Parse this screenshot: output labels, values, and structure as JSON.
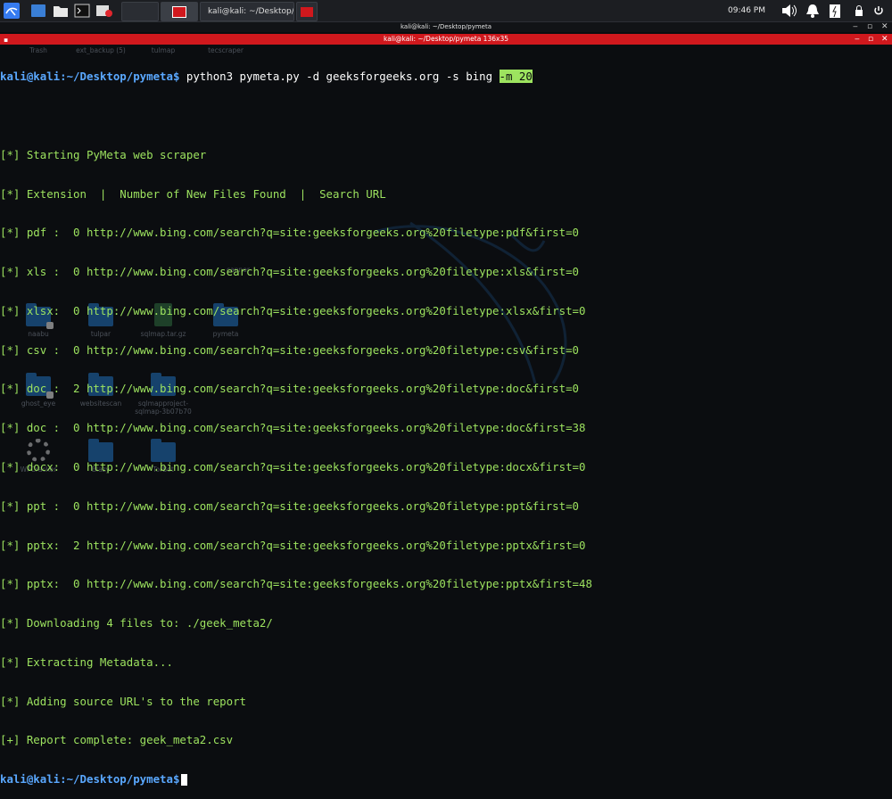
{
  "panel": {
    "tasks": [
      {
        "label": "kali@kali: ~/Desktop/py..."
      }
    ],
    "clock": "09:46 PM",
    "icons": [
      "kali-menu-icon",
      "workspace-icon",
      "files-icon",
      "terminal-icon",
      "screenrecorder-icon",
      "speaker-icon",
      "notification-icon",
      "power-manager-icon",
      "lock-icon",
      "power-icon"
    ]
  },
  "terminal": {
    "title_small": "kali@kali: ~/Desktop/pymeta",
    "title": "kali@kali: ~/Desktop/pymeta 136x35",
    "prompt_user": "kali@kali",
    "prompt_path": ":~/Desktop/pymeta$",
    "command": " python3 pymeta.py -d geeksforgeeks.org -s bing ",
    "command_tail": "-m 20",
    "lines": [
      "[*] Starting PyMeta web scraper",
      "[*] Extension  |  Number of New Files Found  |  Search URL",
      "[*] pdf :  0 http://www.bing.com/search?q=site:geeksforgeeks.org%20filetype:pdf&first=0",
      "[*] xls :  0 http://www.bing.com/search?q=site:geeksforgeeks.org%20filetype:xls&first=0",
      "[*] xlsx:  0 http://www.bing.com/search?q=site:geeksforgeeks.org%20filetype:xlsx&first=0",
      "[*] csv :  0 http://www.bing.com/search?q=site:geeksforgeeks.org%20filetype:csv&first=0",
      "[*] doc :  2 http://www.bing.com/search?q=site:geeksforgeeks.org%20filetype:doc&first=0",
      "[*] doc :  0 http://www.bing.com/search?q=site:geeksforgeeks.org%20filetype:doc&first=38",
      "[*] docx:  0 http://www.bing.com/search?q=site:geeksforgeeks.org%20filetype:docx&first=0",
      "[*] ppt :  0 http://www.bing.com/search?q=site:geeksforgeeks.org%20filetype:ppt&first=0",
      "[*] pptx:  2 http://www.bing.com/search?q=site:geeksforgeeks.org%20filetype:pptx&first=0",
      "[*] pptx:  0 http://www.bing.com/search?q=site:geeksforgeeks.org%20filetype:pptx&first=48",
      "[*] Downloading 4 files to: ./geek_meta2/",
      "[*] Extracting Metadata...",
      "[*] Adding source URL's to the report",
      "[+] Report complete: geek_meta2.csv"
    ],
    "final_prompt_user": "kali@kali",
    "final_prompt_path": ":~/Desktop/pymeta$"
  },
  "desktop": {
    "row0": [
      "Trash",
      "ext_backup (5)",
      "tulmap",
      "tecscraper"
    ],
    "row1": [
      "naabu",
      "tulpar",
      "sqlmap.tar.gz",
      "pymeta"
    ],
    "row2": [
      "ghost_eye",
      "websitescan",
      "sqlmapproject-sqlmap-3b07b70",
      ""
    ],
    "row3": [
      "WPCracker",
      "Blazy",
      "TorBot",
      ""
    ],
    "misc": "canner"
  }
}
